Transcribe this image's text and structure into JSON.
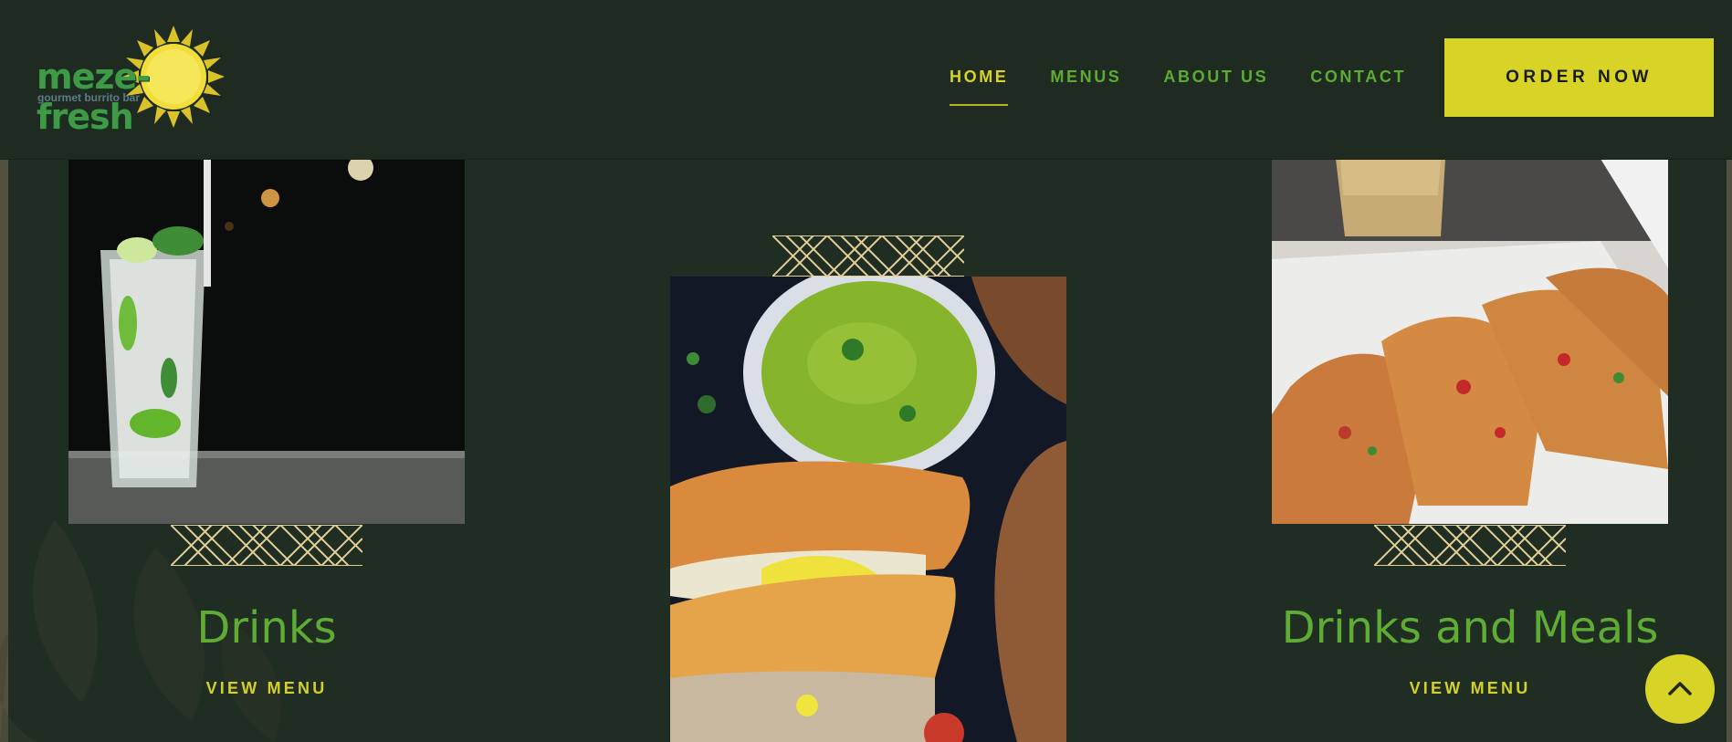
{
  "brand": {
    "name": "meze-fresh",
    "tagline": "gourmet burrito bar"
  },
  "nav": {
    "items": [
      {
        "label": "HOME",
        "active": true
      },
      {
        "label": "MENUS",
        "active": false
      },
      {
        "label": "ABOUT US",
        "active": false
      },
      {
        "label": "CONTACT",
        "active": false
      }
    ],
    "cta_label": "ORDER NOW"
  },
  "cards": [
    {
      "title": "Drinks",
      "link_label": "VIEW MENU"
    },
    {
      "title": "",
      "link_label": ""
    },
    {
      "title": "Drinks and Meals",
      "link_label": "VIEW MENU"
    }
  ],
  "colors": {
    "background": "#202d22",
    "accent": "#d7d427",
    "green": "#5fac35",
    "pattern": "#e2cf97"
  },
  "icons": {
    "scroll_top": "chevron-up-icon",
    "logo": "sun-icon"
  }
}
